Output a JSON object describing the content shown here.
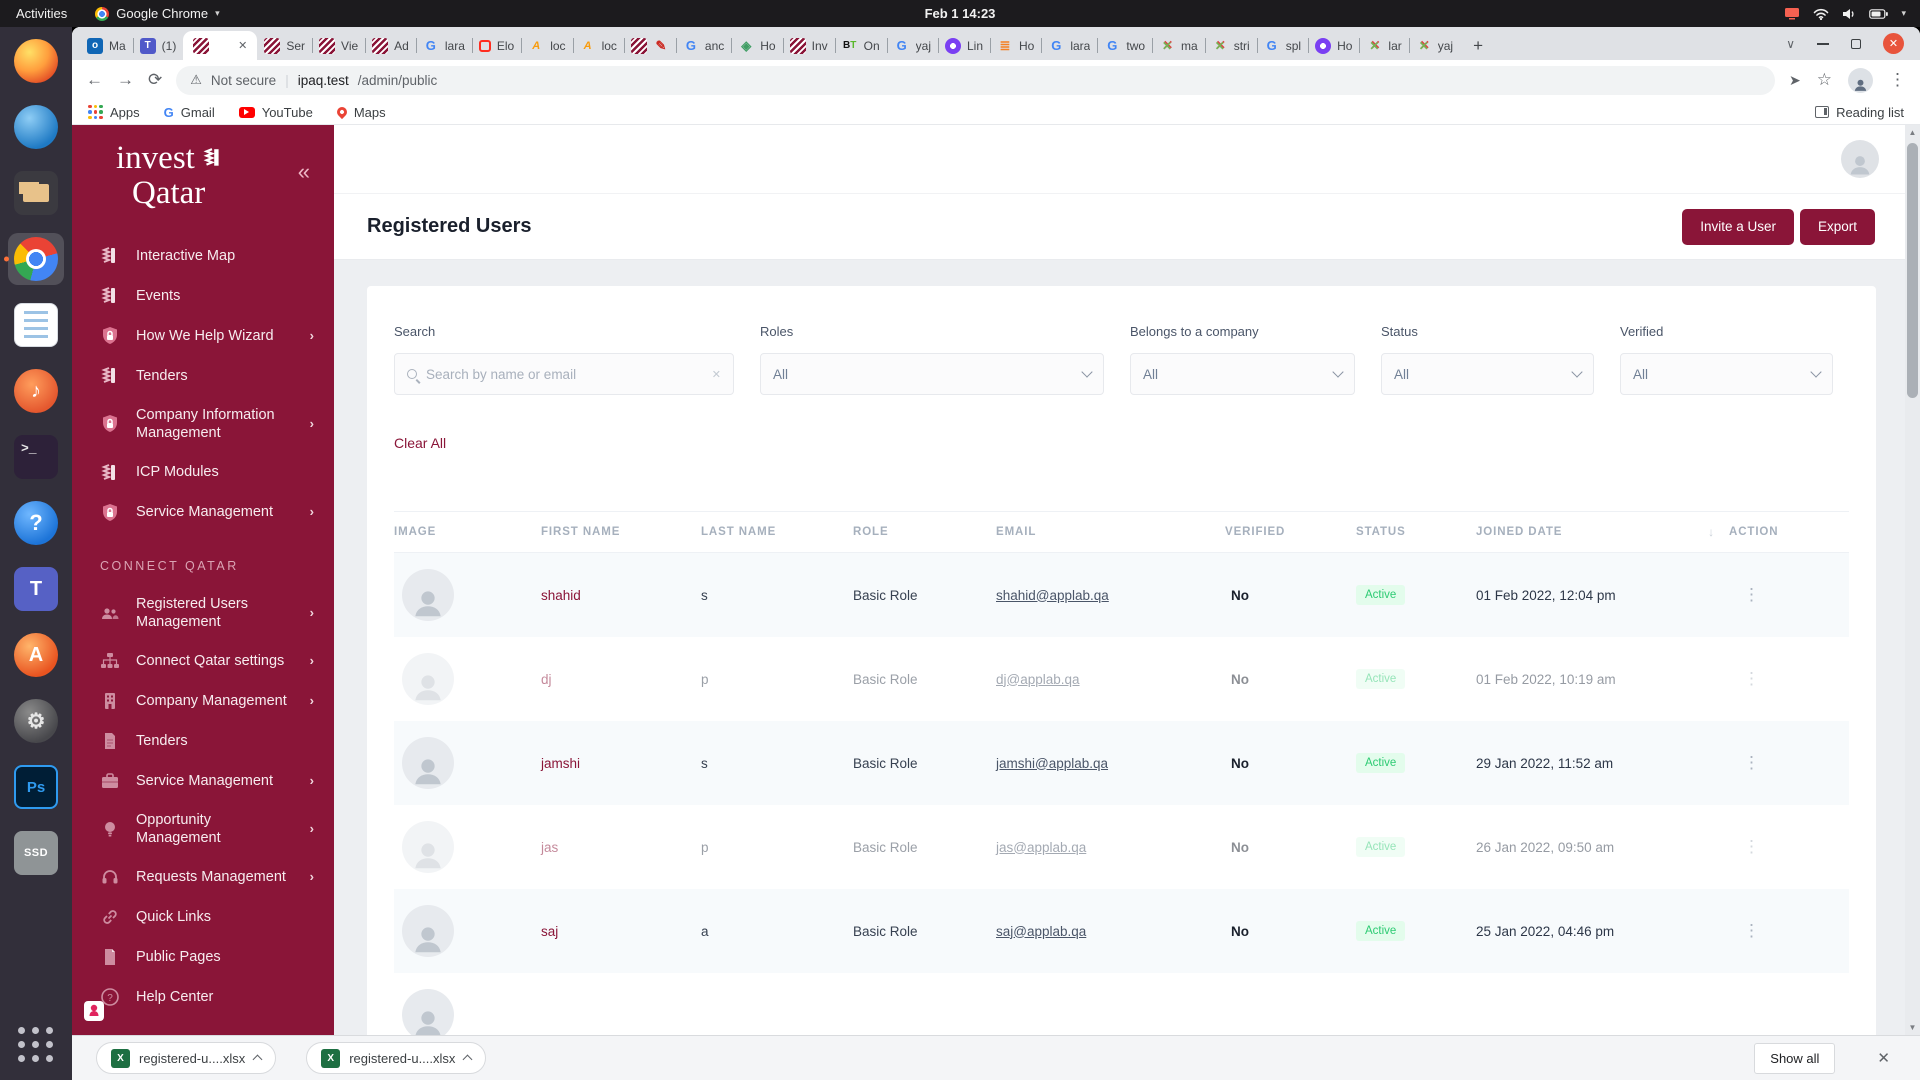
{
  "gnome": {
    "activities": "Activities",
    "app_name": "Google Chrome",
    "clock": "Feb 1 14:23"
  },
  "dock": {
    "items": [
      {
        "id": "firefox",
        "label": "Firefox"
      },
      {
        "id": "thunderbird",
        "label": "Thunderbird"
      },
      {
        "id": "files",
        "label": "Files"
      },
      {
        "id": "chrome",
        "label": "Google Chrome",
        "active": true
      },
      {
        "id": "writer",
        "label": "LibreOffice Writer"
      },
      {
        "id": "rhythmbox",
        "label": "Rhythmbox"
      },
      {
        "id": "terminal",
        "label": "Terminal"
      },
      {
        "id": "help",
        "label": "Help"
      },
      {
        "id": "teams",
        "label": "Teams"
      },
      {
        "id": "software",
        "label": "Ubuntu Software"
      },
      {
        "id": "settings",
        "label": "Settings"
      },
      {
        "id": "photoshop",
        "label": "Photoshop"
      },
      {
        "id": "ssd",
        "label": "SSD"
      },
      {
        "id": "app-grid",
        "label": "Show Applications"
      }
    ]
  },
  "chrome": {
    "tabs": [
      {
        "icon": "outlook",
        "label": "Ma"
      },
      {
        "icon": "teams",
        "label": "(1)"
      },
      {
        "icon": "iq",
        "label": "",
        "active": true
      },
      {
        "icon": "iq",
        "label": "Ser"
      },
      {
        "icon": "iq",
        "label": "Vie"
      },
      {
        "icon": "iq",
        "label": "Ad"
      },
      {
        "icon": "google",
        "label": "lara"
      },
      {
        "icon": "laravel",
        "label": "Elo"
      },
      {
        "icon": "pma",
        "label": "loc"
      },
      {
        "icon": "pma",
        "label": "loc"
      },
      {
        "icon": "iq",
        "icon2": "pencil",
        "label": ""
      },
      {
        "icon": "google",
        "label": "anc"
      },
      {
        "icon": "diamond",
        "label": "Ho"
      },
      {
        "icon": "iq",
        "label": "Inv"
      },
      {
        "icon": "bt",
        "label": "On"
      },
      {
        "icon": "google",
        "label": "yaj"
      },
      {
        "icon": "purple",
        "label": "Lin"
      },
      {
        "icon": "stack",
        "label": "Ho"
      },
      {
        "icon": "google",
        "label": "lara"
      },
      {
        "icon": "google",
        "label": "two"
      },
      {
        "icon": "xmark",
        "label": "ma"
      },
      {
        "icon": "xmark",
        "label": "stri"
      },
      {
        "icon": "google",
        "label": "spl"
      },
      {
        "icon": "purple",
        "label": "Ho"
      },
      {
        "icon": "xmark",
        "label": "lar"
      },
      {
        "icon": "xmark",
        "label": "yaj"
      }
    ],
    "new_tab": "+",
    "toolbar": {
      "security": "Not secure",
      "url_host": "ipaq.test",
      "url_path": "/admin/public"
    },
    "bookmarks": {
      "items": [
        {
          "icon": "apps-grid",
          "label": "Apps"
        },
        {
          "icon": "gmail",
          "label": "Gmail"
        },
        {
          "icon": "youtube",
          "label": "YouTube"
        },
        {
          "icon": "maps",
          "label": "Maps"
        }
      ],
      "reading_list": "Reading list"
    }
  },
  "sidebar": {
    "logo_line1": "invest",
    "logo_line2": "Qatar",
    "sections": [
      {
        "items": [
          {
            "icon": "flag",
            "label": "Interactive Map"
          },
          {
            "icon": "flag",
            "label": "Events"
          },
          {
            "icon": "shield-lock",
            "label": "How We Help Wizard",
            "chevron": true
          },
          {
            "icon": "flag",
            "label": "Tenders"
          },
          {
            "icon": "shield-lock",
            "label": "Company Information Management",
            "chevron": true
          },
          {
            "icon": "flag",
            "label": "ICP Modules"
          },
          {
            "icon": "shield-lock",
            "label": "Service Management",
            "chevron": true
          }
        ]
      },
      {
        "header": "CONNECT QATAR",
        "items": [
          {
            "icon": "users",
            "label": "Registered Users Management",
            "chevron": true
          },
          {
            "icon": "sitemap",
            "label": "Connect Qatar settings",
            "chevron": true
          },
          {
            "icon": "building",
            "label": "Company Management",
            "chevron": true
          },
          {
            "icon": "doc",
            "label": "Tenders"
          },
          {
            "icon": "briefcase",
            "label": "Service Management",
            "chevron": true
          },
          {
            "icon": "bulb",
            "label": "Opportunity Management",
            "chevron": true
          },
          {
            "icon": "headset",
            "label": "Requests Management",
            "chevron": true
          },
          {
            "icon": "link",
            "label": "Quick Links"
          },
          {
            "icon": "file",
            "label": "Public Pages"
          },
          {
            "icon": "question",
            "label": "Help Center"
          }
        ]
      }
    ]
  },
  "page": {
    "title": "Registered Users",
    "invite_button": "Invite a User",
    "export_button": "Export"
  },
  "filters": {
    "search_label": "Search",
    "search_placeholder": "Search by name or email",
    "selects": [
      {
        "id": "roles",
        "label": "Roles",
        "value": "All"
      },
      {
        "id": "company",
        "label": "Belongs to a company",
        "value": "All"
      },
      {
        "id": "status",
        "label": "Status",
        "value": "All"
      },
      {
        "id": "verified",
        "label": "Verified",
        "value": "All"
      }
    ],
    "clear_all": "Clear All"
  },
  "table": {
    "headers": [
      "IMAGE",
      "FIRST NAME",
      "LAST NAME",
      "ROLE",
      "EMAIL",
      "VERIFIED",
      "STATUS",
      "JOINED DATE",
      "ACTION"
    ],
    "rows": [
      {
        "first": "shahid",
        "last": "s",
        "role": "Basic Role",
        "email": "shahid@applab.qa",
        "verified": "No",
        "status": "Active",
        "joined": "01 Feb 2022, 12:04 pm"
      },
      {
        "first": "dj",
        "last": "p",
        "role": "Basic Role",
        "email": "dj@applab.qa",
        "verified": "No",
        "status": "Active",
        "joined": "01 Feb 2022, 10:19 am",
        "muted": true
      },
      {
        "first": "jamshi",
        "last": "s",
        "role": "Basic Role",
        "email": "jamshi@applab.qa",
        "verified": "No",
        "status": "Active",
        "joined": "29 Jan 2022, 11:52 am"
      },
      {
        "first": "jas",
        "last": "p",
        "role": "Basic Role",
        "email": "jas@applab.qa",
        "verified": "No",
        "status": "Active",
        "joined": "26 Jan 2022, 09:50 am",
        "muted": true
      },
      {
        "first": "saj",
        "last": "a",
        "role": "Basic Role",
        "email": "saj@applab.qa",
        "verified": "No",
        "status": "Active",
        "joined": "25 Jan 2022, 04:46 pm"
      }
    ],
    "partial_row_visible": true
  },
  "downloads": {
    "files": [
      "registered-u....xlsx",
      "registered-u....xlsx"
    ],
    "show_all": "Show all"
  },
  "colors": {
    "brand": "#8A1538",
    "badge_text": "#2dcb73",
    "badge_bg": "#e3fcec",
    "active_row": "#f7fafc"
  }
}
